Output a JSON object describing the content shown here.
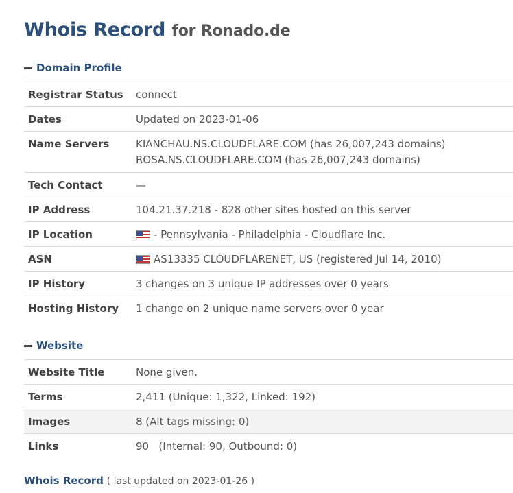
{
  "title": {
    "main": "Whois Record",
    "for": "for Ronado.de"
  },
  "sections": {
    "domain_profile": "Domain Profile",
    "website": "Website"
  },
  "domain_profile": {
    "registrar_status": {
      "label": "Registrar Status",
      "value": "connect"
    },
    "dates": {
      "label": "Dates",
      "value": "Updated on 2023-01-06"
    },
    "name_servers": {
      "label": "Name Servers",
      "line1": "KIANCHAU.NS.CLOUDFLARE.COM (has 26,007,243 domains)",
      "line2": "ROSA.NS.CLOUDFLARE.COM (has 26,007,243 domains)"
    },
    "tech_contact": {
      "label": "Tech Contact",
      "value": "—"
    },
    "ip_address": {
      "label": "IP Address",
      "value": "104.21.37.218 - 828 other sites hosted on this server"
    },
    "ip_location": {
      "label": "IP Location",
      "value": "- Pennsylvania - Philadelphia - Cloudflare Inc."
    },
    "asn": {
      "label": "ASN",
      "value": "AS13335 CLOUDFLARENET, US (registered Jul 14, 2010)"
    },
    "ip_history": {
      "label": "IP History",
      "value": "3 changes on 3 unique IP addresses over 0 years"
    },
    "hosting_history": {
      "label": "Hosting History",
      "value": "1 change on 2 unique name servers over 0 year"
    }
  },
  "website": {
    "title": {
      "label": "Website Title",
      "value": "None given."
    },
    "terms": {
      "label": "Terms",
      "value": "2,411 (Unique: 1,322, Linked: 192)"
    },
    "images": {
      "label": "Images",
      "value": "8 (Alt tags missing: 0)"
    },
    "links": {
      "label": "Links",
      "value": "90   (Internal: 90, Outbound: 0)"
    }
  },
  "footer": {
    "link": "Whois Record",
    "note": "( last updated on 2023-01-26 )"
  },
  "icons": {
    "flag": "us-flag-icon",
    "collapse": "minus-icon"
  }
}
